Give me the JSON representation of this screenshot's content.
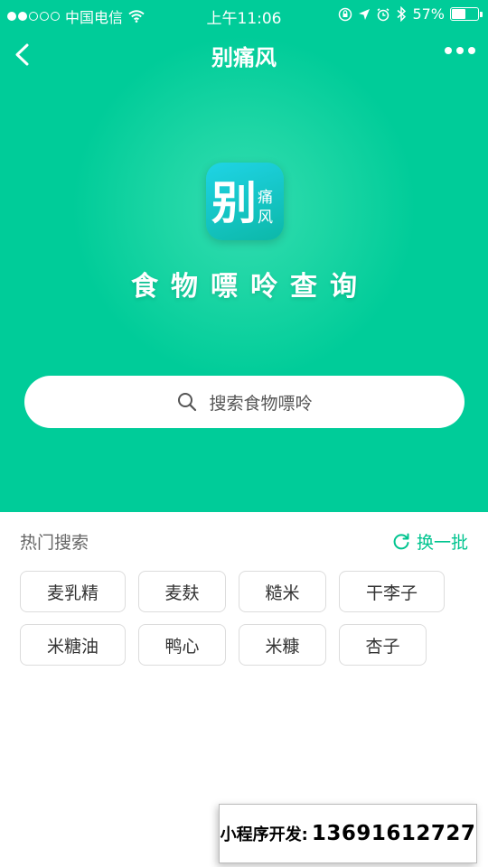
{
  "status_bar": {
    "carrier": "中国电信",
    "time": "上午11:06",
    "battery": "57%",
    "battery_level": 0.57,
    "signal_bars_filled": 2,
    "signal_bars_total": 5
  },
  "nav": {
    "title": "别痛风",
    "back_icon": "chevron-left-icon",
    "more_icon": "more-dots-icon"
  },
  "hero": {
    "logo_text": "别",
    "logo_subtext_1": "痛",
    "logo_subtext_2": "风",
    "title": "食物嘌呤查询",
    "search_placeholder": "搜索食物嘌呤"
  },
  "hot_search": {
    "title": "热门搜索",
    "refresh_label": "换一批",
    "tags": [
      "麦乳精",
      "麦麸",
      "糙米",
      "干李子",
      "米糖油",
      "鸭心",
      "米糠",
      "杏子"
    ]
  },
  "promo": {
    "label": "小程序开发:",
    "phone": "13691612727"
  },
  "colors": {
    "brand_green": "#00cc99",
    "accent_green": "#00c48f"
  }
}
